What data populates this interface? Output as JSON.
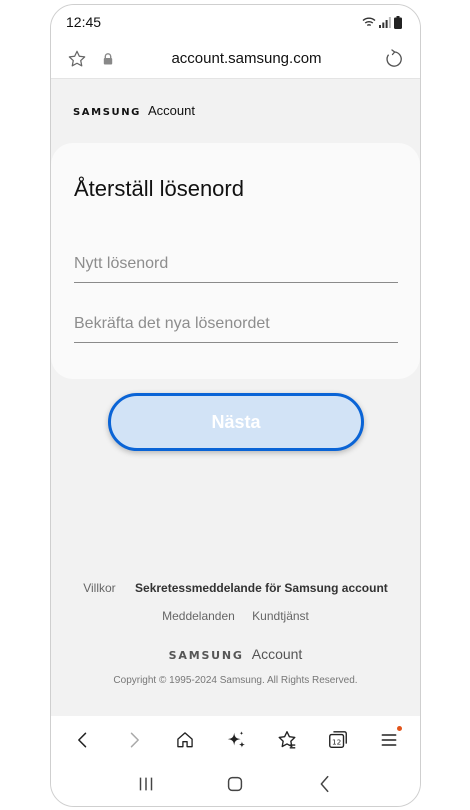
{
  "status": {
    "time": "12:45"
  },
  "browser": {
    "url": "account.samsung.com",
    "icons": [
      "star-icon",
      "lock-icon",
      "reload-icon"
    ]
  },
  "header": {
    "brand_samsung": "SAMSUNG",
    "brand_account": "Account"
  },
  "form": {
    "title": "Återställ lösenord",
    "new_password_placeholder": "Nytt lösenord",
    "confirm_password_placeholder": "Bekräfta det nya lösenordet",
    "next_label": "Nästa"
  },
  "footer": {
    "links": [
      "Villkor",
      "Sekretessmeddelande för Samsung account",
      "Meddelanden",
      "Kundtjänst"
    ],
    "brand_samsung": "SAMSUNG",
    "brand_account": "Account",
    "copyright": "Copyright © 1995-2024 Samsung. All Rights Reserved."
  },
  "toolbar": {
    "tab_count": "12",
    "icons": [
      "back-icon",
      "forward-icon",
      "home-icon",
      "ai-sparkle-icon",
      "bookmarks-icon",
      "tabs-icon",
      "menu-icon"
    ]
  },
  "nav": {
    "icons": [
      "recents-icon",
      "home-icon",
      "back-icon"
    ]
  },
  "colors": {
    "accent": "#0a64d6",
    "button_fill": "#d2e3f6",
    "background": "#f2f2f2",
    "badge": "#e2541b"
  }
}
